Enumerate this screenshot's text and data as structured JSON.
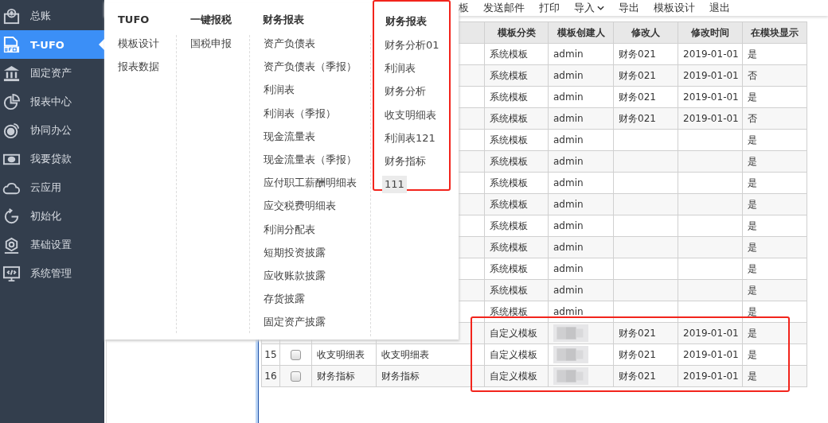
{
  "sidebar": {
    "items": [
      {
        "label": "总账",
        "selected": false
      },
      {
        "label": "T-UFO",
        "selected": true
      },
      {
        "label": "固定资产",
        "selected": false
      },
      {
        "label": "报表中心",
        "selected": false
      },
      {
        "label": "协同办公",
        "selected": false
      },
      {
        "label": "我要贷款",
        "selected": false
      },
      {
        "label": "云应用",
        "selected": false
      },
      {
        "label": "初始化",
        "selected": false
      },
      {
        "label": "基础设置",
        "selected": false
      },
      {
        "label": "系统管理",
        "selected": false
      }
    ]
  },
  "toolbar": [
    {
      "label": "板",
      "caret": false
    },
    {
      "label": "发送邮件",
      "caret": false
    },
    {
      "label": "打印",
      "caret": false
    },
    {
      "label": "导入",
      "caret": true
    },
    {
      "label": "导出",
      "caret": false
    },
    {
      "label": "模板设计",
      "caret": false
    },
    {
      "label": "退出",
      "caret": false
    }
  ],
  "dropdown": {
    "columns": [
      {
        "title": "TUFO",
        "highlighted": false,
        "items": [
          {
            "label": "模板设计",
            "selected": false
          },
          {
            "label": "报表数据",
            "selected": false
          }
        ]
      },
      {
        "title": "一键报税",
        "highlighted": false,
        "items": [
          {
            "label": "国税申报",
            "selected": false
          }
        ]
      },
      {
        "title": "财务报表",
        "highlighted": false,
        "items": [
          {
            "label": "资产负债表",
            "selected": false
          },
          {
            "label": "资产负债表（季报）",
            "selected": false
          },
          {
            "label": "利润表",
            "selected": false
          },
          {
            "label": "利润表（季报）",
            "selected": false
          },
          {
            "label": "现金流量表",
            "selected": false
          },
          {
            "label": "现金流量表（季报）",
            "selected": false
          },
          {
            "label": "应付职工薪酬明细表",
            "selected": false
          },
          {
            "label": "应交税费明细表",
            "selected": false
          },
          {
            "label": "利润分配表",
            "selected": false
          },
          {
            "label": "短期投资披露",
            "selected": false
          },
          {
            "label": "应收账款披露",
            "selected": false
          },
          {
            "label": "存货披露",
            "selected": false
          },
          {
            "label": "固定资产披露",
            "selected": false
          }
        ]
      },
      {
        "title": "财务报表",
        "highlighted": true,
        "items": [
          {
            "label": "财务分析01",
            "selected": false
          },
          {
            "label": "利润表",
            "selected": false
          },
          {
            "label": "财务分析",
            "selected": false
          },
          {
            "label": "收支明细表",
            "selected": false
          },
          {
            "label": "利润表121",
            "selected": false
          },
          {
            "label": "财务指标",
            "selected": false
          },
          {
            "label": "111",
            "selected": true
          }
        ]
      }
    ]
  },
  "table": {
    "columns": [
      "模板分类",
      "模板创建人",
      "修改人",
      "修改时间",
      "在模块显示"
    ],
    "rows": [
      {
        "category": "系统模板",
        "creator": "admin",
        "modifier": "财务021",
        "time": "2019-01-01",
        "shown": "是",
        "highlighted": false
      },
      {
        "category": "系统模板",
        "creator": "admin",
        "modifier": "财务021",
        "time": "2019-01-01",
        "shown": "否",
        "highlighted": false
      },
      {
        "category": "系统模板",
        "creator": "admin",
        "modifier": "财务021",
        "time": "2019-01-01",
        "shown": "是",
        "highlighted": false
      },
      {
        "category": "系统模板",
        "creator": "admin",
        "modifier": "财务021",
        "time": "2019-01-01",
        "shown": "否",
        "highlighted": false
      },
      {
        "category": "系统模板",
        "creator": "admin",
        "shown": "是",
        "highlighted": false
      },
      {
        "category": "系统模板",
        "creator": "admin",
        "shown": "是",
        "highlighted": false
      },
      {
        "category": "系统模板",
        "creator": "admin",
        "shown": "是",
        "highlighted": false
      },
      {
        "category": "系统模板",
        "creator": "admin",
        "shown": "是",
        "highlighted": false
      },
      {
        "category": "系统模板",
        "creator": "admin",
        "shown": "是",
        "highlighted": false
      },
      {
        "category": "系统模板",
        "creator": "admin",
        "shown": "是",
        "highlighted": false
      },
      {
        "category": "系统模板",
        "creator": "admin",
        "shown": "是",
        "highlighted": false
      },
      {
        "category": "系统模板",
        "creator": "admin",
        "shown": "是",
        "highlighted": false
      },
      {
        "category": "系统模板",
        "creator": "admin",
        "shown": "是",
        "highlighted": false
      },
      {
        "category": "自定义模板",
        "creator_redacted": true,
        "modifier": "财务021",
        "time": "2019-01-01",
        "shown": "是",
        "highlighted": true
      },
      {
        "index": "15",
        "checked": false,
        "name": "收支明细表",
        "column_4": "收支明细表",
        "category": "自定义模板",
        "creator_redacted": true,
        "modifier": "财务021",
        "time": "2019-01-01",
        "shown": "是",
        "highlighted": true
      },
      {
        "index": "16",
        "checked": false,
        "name": "财务指标",
        "column_4": "财务指标",
        "category": "自定义模板",
        "creator_redacted": true,
        "modifier": "财务021",
        "time": "2019-01-01",
        "shown": "是",
        "highlighted": true
      }
    ]
  }
}
